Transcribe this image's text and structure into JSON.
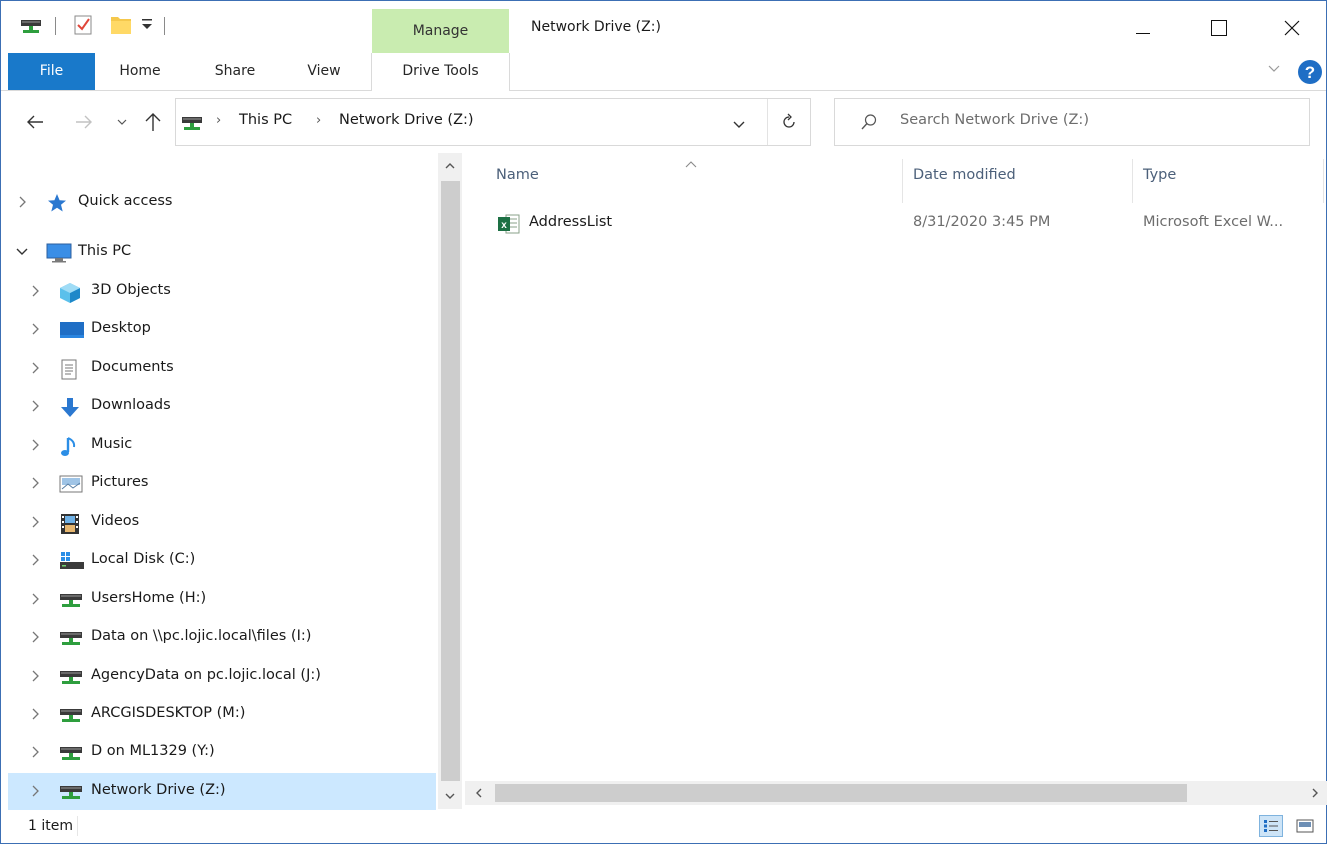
{
  "window": {
    "title": "Network Drive (Z:)",
    "contextual_tab_group": "Manage",
    "help_label": "?"
  },
  "ribbon": {
    "tabs": [
      "File",
      "Home",
      "Share",
      "View",
      "Drive Tools"
    ]
  },
  "address": {
    "crumbs": [
      "This PC",
      "Network Drive (Z:)"
    ],
    "search_placeholder": "Search Network Drive (Z:)"
  },
  "nav": {
    "items": [
      {
        "label": "Quick access",
        "icon": "star-icon",
        "state": "collapsed"
      },
      {
        "label": "This PC",
        "icon": "computer-icon",
        "state": "expanded"
      },
      {
        "label": "3D Objects",
        "icon": "cube-icon",
        "state": "collapsed"
      },
      {
        "label": "Desktop",
        "icon": "desktop-icon",
        "state": "collapsed"
      },
      {
        "label": "Documents",
        "icon": "document-icon",
        "state": "collapsed"
      },
      {
        "label": "Downloads",
        "icon": "download-arrow-icon",
        "state": "collapsed"
      },
      {
        "label": "Music",
        "icon": "music-note-icon",
        "state": "collapsed"
      },
      {
        "label": "Pictures",
        "icon": "picture-icon",
        "state": "collapsed"
      },
      {
        "label": "Videos",
        "icon": "film-icon",
        "state": "collapsed"
      },
      {
        "label": "Local Disk (C:)",
        "icon": "local-disk-icon",
        "state": "collapsed"
      },
      {
        "label": "UsersHome (H:)",
        "icon": "network-drive-icon",
        "state": "collapsed"
      },
      {
        "label": "Data on \\\\pc.lojic.local\\files (I:)",
        "icon": "network-drive-icon",
        "state": "collapsed"
      },
      {
        "label": "AgencyData on pc.lojic.local (J:)",
        "icon": "network-drive-icon",
        "state": "collapsed"
      },
      {
        "label": "ARCGISDESKTOP (M:)",
        "icon": "network-drive-icon",
        "state": "collapsed"
      },
      {
        "label": "D on ML1329 (Y:)",
        "icon": "network-drive-icon",
        "state": "collapsed"
      },
      {
        "label": "Network Drive (Z:)",
        "icon": "network-drive-icon",
        "state": "collapsed",
        "selected": true
      }
    ]
  },
  "files": {
    "columns": [
      "Name",
      "Date modified",
      "Type"
    ],
    "rows": [
      {
        "name": "AddressList",
        "date": "8/31/2020 3:45 PM",
        "type": "Microsoft Excel W...",
        "icon": "excel-icon"
      }
    ]
  },
  "status": {
    "item_count": "1 item"
  },
  "colors": {
    "accent": "#1979ca",
    "manage_tab": "#c9ecb0",
    "selection": "#cce8ff"
  }
}
